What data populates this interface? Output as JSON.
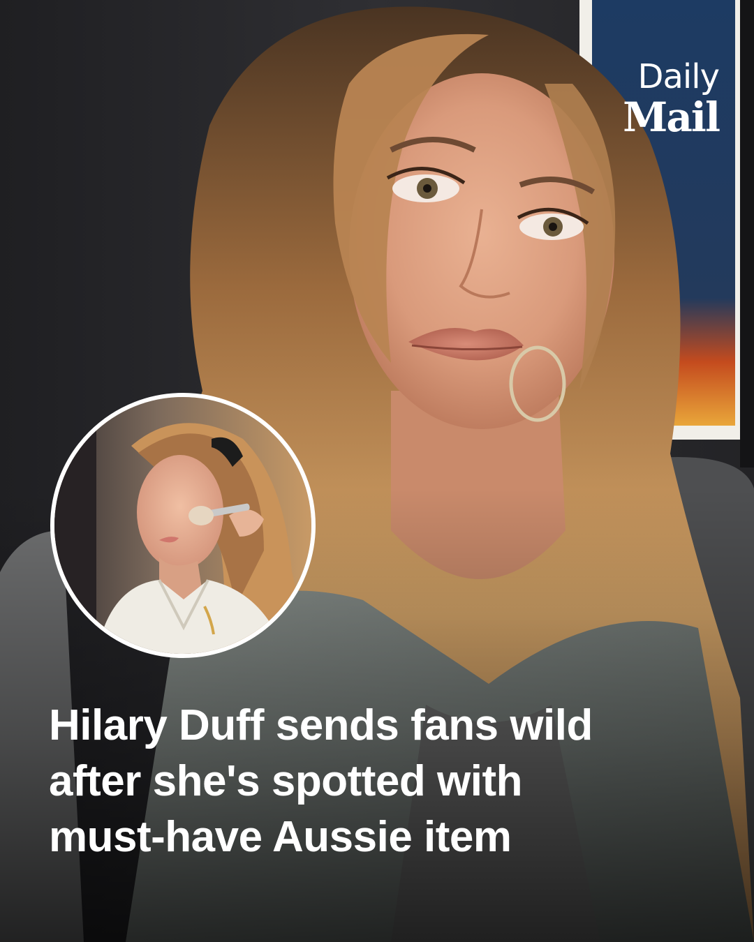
{
  "brand": {
    "name_line1": "Daily",
    "name_line2": "Mail"
  },
  "headline": {
    "lines": [
      "Hilary Duff sends fans wild",
      "after she's spotted with",
      "must-have Aussie item"
    ]
  },
  "images": {
    "main": "woman-with-long-wavy-blonde-hair-portrait",
    "inset": "woman-getting-makeup-brush-applied-to-cheek"
  },
  "colors": {
    "headline_text": "#ffffff",
    "logo_text": "#ffffff",
    "inset_border": "#ffffff"
  }
}
